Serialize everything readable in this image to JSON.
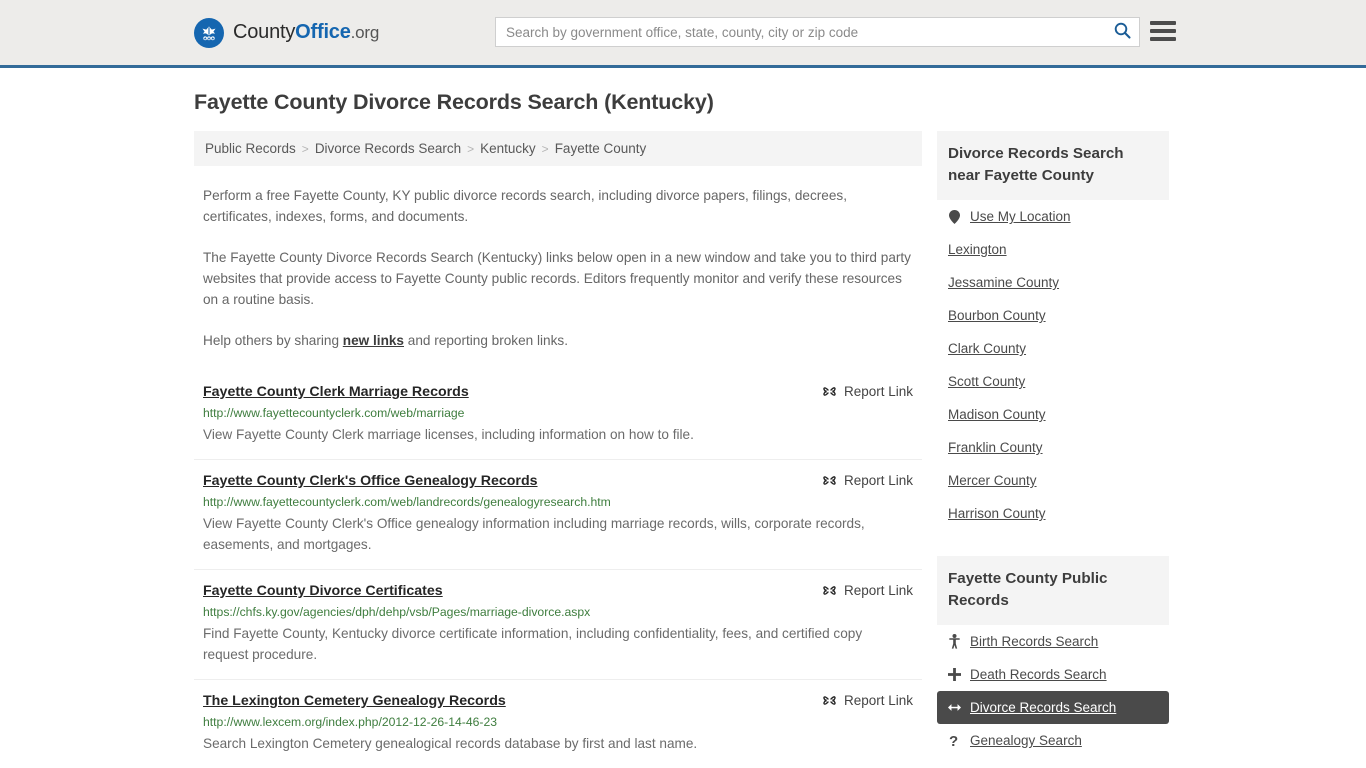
{
  "header": {
    "brand": {
      "part1": "County",
      "part2": "Office",
      "part3": ".org",
      "logo_icon": "eagle-stars-logo"
    },
    "search": {
      "placeholder": "Search by government office, state, county, city or zip code",
      "value": "",
      "button_icon": "search-icon"
    },
    "menu_icon": "hamburger-menu-icon",
    "accent_color": "#336b99"
  },
  "page_title": "Fayette County Divorce Records Search (Kentucky)",
  "breadcrumb": {
    "items": [
      {
        "label": "Public Records"
      },
      {
        "label": "Divorce Records Search"
      },
      {
        "label": "Kentucky"
      },
      {
        "label": "Fayette County"
      }
    ],
    "separator": ">"
  },
  "intro": {
    "p1": "Perform a free Fayette County, KY public divorce records search, including divorce papers, filings, decrees, certificates, indexes, forms, and documents.",
    "p2": "The Fayette County Divorce Records Search (Kentucky) links below open in a new window and take you to third party websites that provide access to Fayette County public records. Editors frequently monitor and verify these resources on a routine basis.",
    "p3_before": "Help others by sharing ",
    "p3_link": "new links",
    "p3_after": " and reporting broken links."
  },
  "results": {
    "report_label": "Report Link",
    "report_icon": "broken-link-icon",
    "items": [
      {
        "title": "Fayette County Clerk Marriage Records",
        "url": "http://www.fayettecountyclerk.com/web/marriage",
        "description": "View Fayette County Clerk marriage licenses, including information on how to file."
      },
      {
        "title": "Fayette County Clerk's Office Genealogy Records",
        "url": "http://www.fayettecountyclerk.com/web/landrecords/genealogyresearch.htm",
        "description": "View Fayette County Clerk's Office genealogy information including marriage records, wills, corporate records, easements, and mortgages."
      },
      {
        "title": "Fayette County Divorce Certificates",
        "url": "https://chfs.ky.gov/agencies/dph/dehp/vsb/Pages/marriage-divorce.aspx",
        "description": "Find Fayette County, Kentucky divorce certificate information, including confidentiality, fees, and certified copy request procedure."
      },
      {
        "title": "The Lexington Cemetery Genealogy Records",
        "url": "http://www.lexcem.org/index.php/2012-12-26-14-46-23",
        "description": "Search Lexington Cemetery genealogical records database by first and last name."
      }
    ]
  },
  "sidebar": {
    "nearby": {
      "title": "Divorce Records Search near Fayette County",
      "items": [
        {
          "label": "Use My Location",
          "icon": "map-pin-icon"
        },
        {
          "label": "Lexington",
          "icon": ""
        },
        {
          "label": "Jessamine County",
          "icon": ""
        },
        {
          "label": "Bourbon County",
          "icon": ""
        },
        {
          "label": "Clark County",
          "icon": ""
        },
        {
          "label": "Scott County",
          "icon": ""
        },
        {
          "label": "Madison County",
          "icon": ""
        },
        {
          "label": "Franklin County",
          "icon": ""
        },
        {
          "label": "Mercer County",
          "icon": ""
        },
        {
          "label": "Harrison County",
          "icon": ""
        }
      ]
    },
    "public_records": {
      "title": "Fayette County Public Records",
      "items": [
        {
          "label": "Birth Records Search",
          "icon": "baby-icon",
          "active": false
        },
        {
          "label": "Death Records Search",
          "icon": "plus-cross-icon",
          "active": false
        },
        {
          "label": "Divorce Records Search",
          "icon": "left-right-arrow-icon",
          "active": true
        },
        {
          "label": "Genealogy Search",
          "icon": "question-mark-icon",
          "active": false
        }
      ],
      "active_background": "#4a4a4a"
    }
  }
}
